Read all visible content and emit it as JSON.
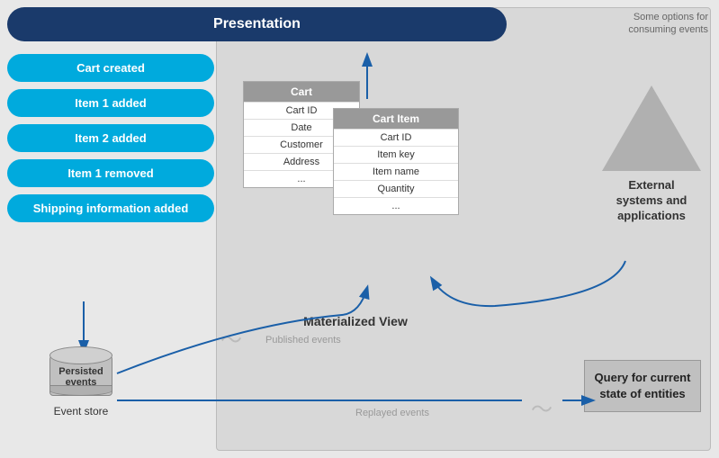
{
  "presentation": {
    "label": "Presentation"
  },
  "events": [
    "Cart created",
    "Item 1 added",
    "Item 2 added",
    "Item 1 removed",
    "Shipping information added"
  ],
  "event_store": {
    "cylinder_label": "Persisted events",
    "label": "Event store"
  },
  "materialized_view": {
    "label": "Materialized View",
    "cart_table": {
      "header": "Cart",
      "rows": [
        "Cart ID",
        "Date",
        "Customer",
        "Address",
        "..."
      ]
    },
    "cart_item_table": {
      "header": "Cart Item",
      "rows": [
        "Cart ID",
        "Item key",
        "Item name",
        "Quantity",
        "..."
      ]
    }
  },
  "some_options_label": "Some options for\nconsuming events",
  "external_systems": {
    "label": "External\nsystems and\napplications"
  },
  "published_events_label": "Published events",
  "replayed_events_label": "Replayed events",
  "query_box": {
    "label": "Query for\ncurrent state\nof entities"
  }
}
